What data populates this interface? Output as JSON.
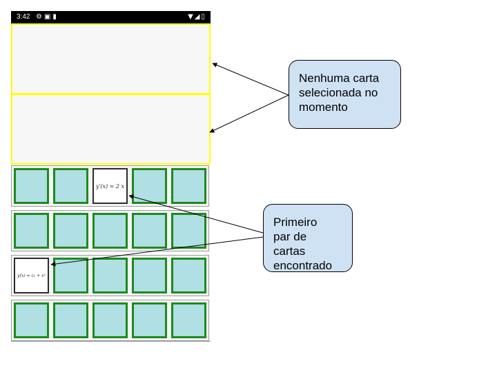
{
  "status_bar": {
    "time": "3:42",
    "left_icons": [
      "gear-icon",
      "image-icon",
      "sd-card-icon"
    ],
    "right_icons": [
      "wifi-icon",
      "signal-icon",
      "battery-icon"
    ]
  },
  "board": {
    "selection_slots": [
      "",
      ""
    ],
    "rows": [
      [
        {
          "state": "down"
        },
        {
          "state": "down"
        },
        {
          "state": "up",
          "text": "y′(x) = 2 x"
        },
        {
          "state": "down"
        },
        {
          "state": "down"
        }
      ],
      [
        {
          "state": "down"
        },
        {
          "state": "down"
        },
        {
          "state": "down"
        },
        {
          "state": "down"
        },
        {
          "state": "down"
        }
      ],
      [
        {
          "state": "up",
          "text": "y(x) = c₁ + x²"
        },
        {
          "state": "down"
        },
        {
          "state": "down"
        },
        {
          "state": "down"
        },
        {
          "state": "down"
        }
      ],
      [
        {
          "state": "down"
        },
        {
          "state": "down"
        },
        {
          "state": "down"
        },
        {
          "state": "down"
        },
        {
          "state": "down"
        }
      ]
    ],
    "card_back_color": "#b0dfe4",
    "card_border_color": "#1c8a1c",
    "slot_border_color": "#ffff00"
  },
  "annotations": {
    "top_callout": "Nenhuma carta\nselecionada no\nmomento",
    "bottom_callout": "Primeiro\npar de\ncartas\nencontrado",
    "callout_fill": "#cfe2f3"
  }
}
